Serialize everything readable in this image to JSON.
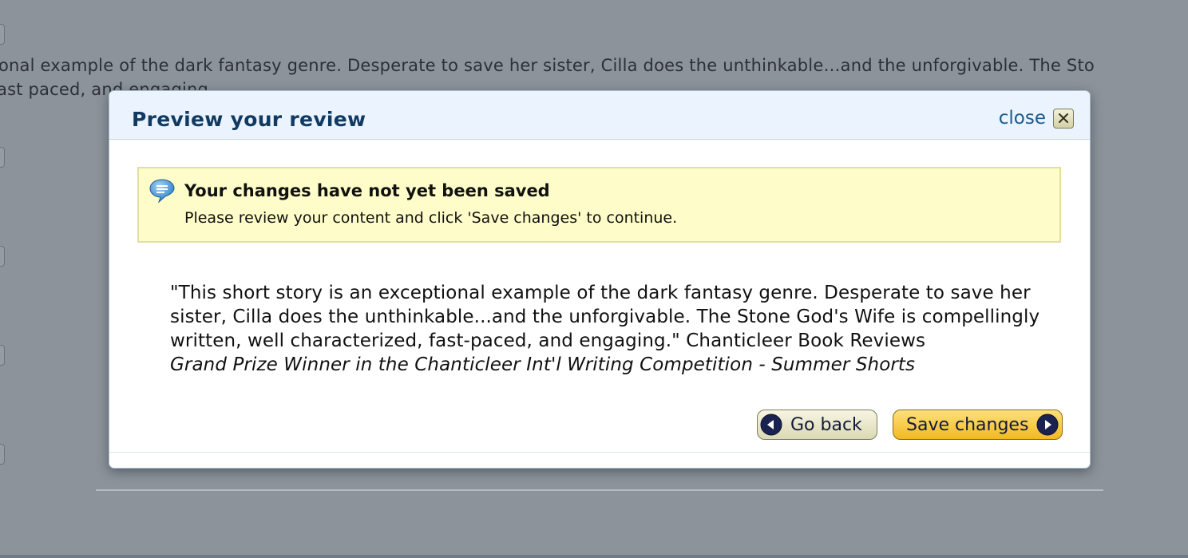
{
  "background": {
    "line1": "onal example of the dark fantasy genre. Desperate to save her sister, Cilla does the unthinkable…and the unforgivable. The Sto",
    "line2": "ast paced, and engaging."
  },
  "modal": {
    "title": "Preview your review",
    "close_label": "close"
  },
  "alert": {
    "title": "Your changes have not yet been saved",
    "message": "Please review your content and click 'Save changes' to continue."
  },
  "review": {
    "quote": "\"This short story is an exceptional example of the dark fantasy genre. Desperate to save her sister, Cilla does the unthinkable...and the unforgivable. The Stone God's Wife is compellingly written, well characterized, fast-paced, and engaging.\" Chanticleer Book Reviews",
    "award": "Grand Prize Winner in the Chanticleer Int'l Writing Competition - Summer Shorts"
  },
  "buttons": {
    "go_back": "Go back",
    "save_changes": "Save changes"
  },
  "colors": {
    "overlay": "#8c939b",
    "header_bg": "#eaf3fe",
    "title": "#113a62",
    "alert_bg": "#fefdc9",
    "save_button": "#f3b920",
    "arrow_circle": "#1a2350"
  }
}
